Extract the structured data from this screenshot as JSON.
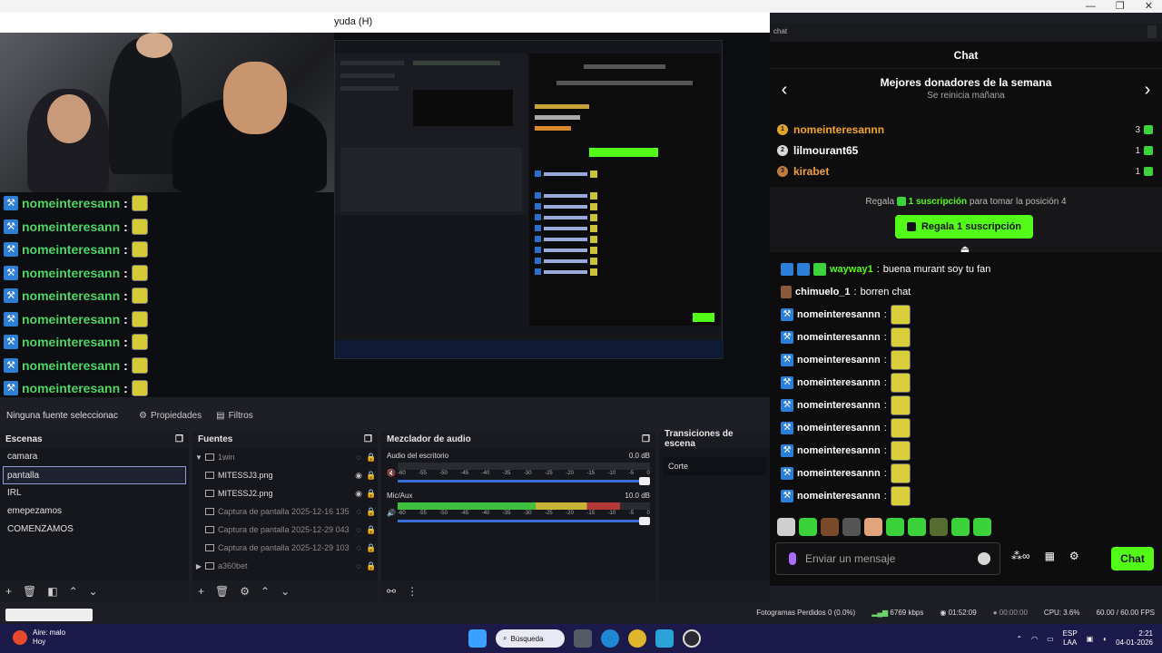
{
  "obs": {
    "menu_help": "yuda (H)",
    "preview_overlay": {
      "username": "nomeinteresann",
      "separator": ":",
      "rows": 9
    },
    "source_toolbar": {
      "no_source": "Ninguna fuente seleccionac",
      "properties": "Propiedades",
      "filters": "Filtros"
    },
    "scenes": {
      "title": "Escenas",
      "items": [
        "camara",
        "pantalla",
        "IRL",
        "emepezamos",
        "COMENZAMOS"
      ],
      "selected": "pantalla"
    },
    "sources": {
      "title": "Fuentes",
      "items": [
        {
          "label": "1win",
          "dim": true,
          "expand": "▼",
          "visible": false
        },
        {
          "label": "MITESSJ3.png",
          "dim": false,
          "expand": "",
          "visible": true
        },
        {
          "label": "MITESSJ2.png",
          "dim": false,
          "expand": "",
          "visible": true
        },
        {
          "label": "Captura de pantalla 2025-12-16 135",
          "dim": true,
          "expand": "",
          "visible": false
        },
        {
          "label": "Captura de pantalla 2025-12-29 043",
          "dim": true,
          "expand": "",
          "visible": false
        },
        {
          "label": "Captura de pantalla 2025-12-29 103",
          "dim": true,
          "expand": "",
          "visible": false
        },
        {
          "label": "a360bet",
          "dim": true,
          "expand": "▶",
          "visible": false
        }
      ]
    },
    "mixer": {
      "title": "Mezclador de audio",
      "channels": [
        {
          "name": "Audio del escritorio",
          "db": "0.0 dB",
          "level": 0,
          "muted": true
        },
        {
          "name": "Mic/Aux",
          "db": "10.0 dB",
          "level": 0.88,
          "muted": false
        }
      ],
      "scale": [
        "-60",
        "-55",
        "-50",
        "-45",
        "-40",
        "-35",
        "-30",
        "-25",
        "-20",
        "-15",
        "-10",
        "-5",
        "0"
      ]
    },
    "transitions": {
      "title": "Transiciones de escena",
      "current": "Corte"
    },
    "status": {
      "dropped": "Fotogramas Perdidos 0 (0.0%)",
      "kbps": "6769 kbps",
      "stream_time": "01:52:09",
      "rec_time": "00:00:00",
      "cpu": "CPU: 3.6%",
      "fps": "60.00 / 60.00 FPS"
    }
  },
  "chat": {
    "window_tag": "chat",
    "header": "Chat",
    "leaderboard": {
      "title": "Mejores donadores de la semana",
      "subtitle": "Se reinicia mañana",
      "entries": [
        {
          "rank": "1",
          "name": "nomeinteresannn",
          "count": "3",
          "color": "#f5a623",
          "medal": "#e0a52a"
        },
        {
          "rank": "2",
          "name": "lilmourant65",
          "count": "1",
          "color": "#ffffff",
          "medal": "#d8d8d8"
        },
        {
          "rank": "3",
          "name": "kirabet",
          "count": "1",
          "color": "#f0a040",
          "medal": "#c27b3f"
        }
      ]
    },
    "promo": {
      "prefix": "Regala",
      "highlight": "1 suscripción",
      "suffix": "para tomar la posición 4",
      "button": "Regala 1 suscripción"
    },
    "messages": [
      {
        "user": "wayway1",
        "text": "buena murant soy tu fan",
        "user_color": "green"
      },
      {
        "user": "chimuelo_1",
        "text": "borren chat",
        "user_color": "white"
      },
      {
        "user": "nomeinteresannn",
        "text": "",
        "user_color": "white"
      },
      {
        "user": "nomeinteresannn",
        "text": "",
        "user_color": "white"
      },
      {
        "user": "nomeinteresannn",
        "text": "",
        "user_color": "white"
      },
      {
        "user": "nomeinteresannn",
        "text": "",
        "user_color": "white"
      },
      {
        "user": "nomeinteresannn",
        "text": "",
        "user_color": "white"
      },
      {
        "user": "nomeinteresannn",
        "text": "",
        "user_color": "white"
      },
      {
        "user": "nomeinteresannn",
        "text": "",
        "user_color": "white"
      },
      {
        "user": "nomeinteresannn",
        "text": "",
        "user_color": "white"
      },
      {
        "user": "nomeinteresannn",
        "text": "",
        "user_color": "white"
      }
    ],
    "input_placeholder": "Enviar un mensaje",
    "send_label": "Chat"
  },
  "taskbar": {
    "weather_title": "Aire: malo",
    "weather_sub": "Hoy",
    "search": "Búsqueda",
    "lang": "ESP",
    "lang_sub": "LAA",
    "time": "2:21",
    "date": "04-01-2026"
  }
}
